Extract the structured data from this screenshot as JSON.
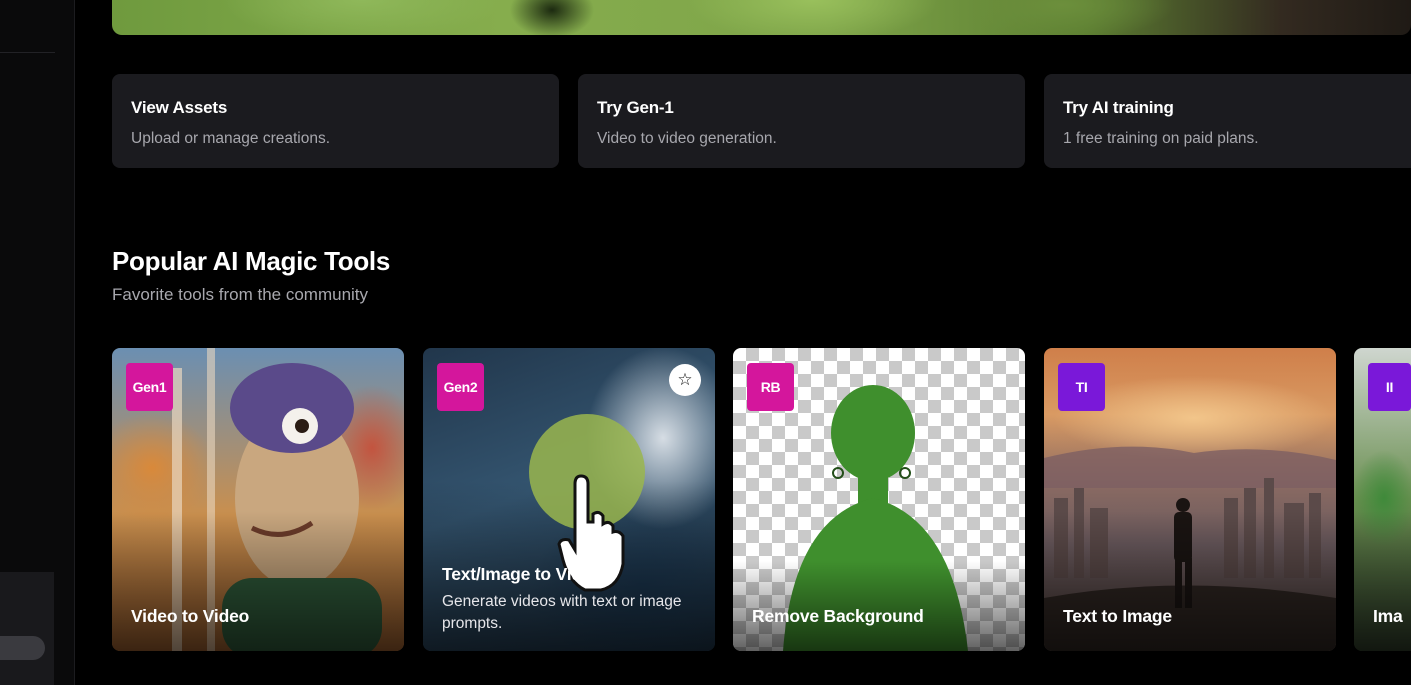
{
  "quick_actions": [
    {
      "title": "View Assets",
      "subtitle": "Upload or manage creations."
    },
    {
      "title": "Try Gen-1",
      "subtitle": "Video to video generation."
    },
    {
      "title": "Try AI training",
      "subtitle": "1 free training on paid plans."
    }
  ],
  "section": {
    "title": "Popular AI Magic Tools",
    "subtitle": "Favorite tools from the community"
  },
  "tools": [
    {
      "badge": "Gen1",
      "badge_color": "#d4169c",
      "label": "Video to Video"
    },
    {
      "badge": "Gen2",
      "badge_color": "#d4169c",
      "label": "Text/Image to Video",
      "description": "Generate videos with text or image prompts."
    },
    {
      "badge": "RB",
      "badge_color": "#d4169c",
      "label": "Remove Background"
    },
    {
      "badge": "TI",
      "badge_color": "#7a18d9",
      "label": "Text to Image"
    },
    {
      "badge": "II",
      "badge_color": "#7a18d9",
      "label": "Ima"
    }
  ],
  "icons": {
    "favorite": "star-outline-icon",
    "cursor": "hand-pointer-icon"
  }
}
